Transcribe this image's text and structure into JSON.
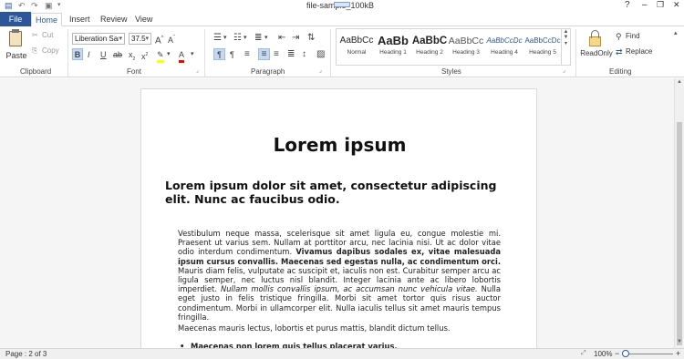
{
  "window": {
    "title": "file-sample_100kB"
  },
  "tabs": [
    {
      "label": "File"
    },
    {
      "label": "Home"
    },
    {
      "label": "Insert"
    },
    {
      "label": "Review"
    },
    {
      "label": "View"
    }
  ],
  "win_controls": {
    "help": "?",
    "minimize": "–",
    "restore": "❐",
    "close": "✕"
  },
  "ribbon": {
    "clipboard": {
      "label": "Clipboard",
      "paste": "Paste",
      "cut": "Cut",
      "copy": "Copy"
    },
    "font": {
      "label": "Font",
      "family": "Liberation Sans",
      "size": "37.5"
    },
    "paragraph": {
      "label": "Paragraph"
    },
    "styles": {
      "label": "Styles",
      "items": [
        {
          "sample": "AaBbCc",
          "name": "Normal"
        },
        {
          "sample": "AaBb",
          "name": "Heading 1"
        },
        {
          "sample": "AaBbC",
          "name": "Heading 2"
        },
        {
          "sample": "AaBbCc",
          "name": "Heading 3"
        },
        {
          "sample": "AaBbCcDc",
          "name": "Heading 4"
        },
        {
          "sample": "AaBbCcDc",
          "name": "Heading 5"
        }
      ]
    },
    "editing": {
      "label": "Editing",
      "readonly": "ReadOnly",
      "find": "Find",
      "replace": "Replace"
    }
  },
  "document": {
    "title": "Lorem ipsum",
    "subtitle": "Lorem ipsum dolor sit amet, consectetur adipiscing elit. Nunc ac faucibus odio.",
    "paragraph1": "Vestibulum neque massa, scelerisque sit amet ligula eu, congue molestie mi. Praesent ut varius sem. Nullam at porttitor arcu, nec lacinia nisi. Ut ac dolor vitae odio interdum condimentum.",
    "paragraph1_bold": "Vivamus dapibus sodales ex, vitae malesuada ipsum cursus convallis. Maecenas sed egestas nulla, ac condimentum orci.",
    "paragraph1_rest": "Mauris diam felis, vulputate ac suscipit et, iaculis non est. Curabitur semper arcu ac ligula semper, nec luctus nisl blandit. Integer lacinia ante ac libero lobortis imperdiet.",
    "paragraph1_italic": "Nullam mollis convallis ipsum, ac accumsan nunc vehicula vitae.",
    "paragraph1_end": "Nulla eget justo in felis tristique fringilla. Morbi sit amet tortor quis risus auctor condimentum. Morbi in ullamcorper elit. Nulla iaculis tellus sit amet mauris tempus fringilla.",
    "paragraph2": "Maecenas mauris lectus, lobortis et purus mattis, blandit dictum tellus.",
    "bullet1": "Maecenas non lorem quis tellus placerat varius."
  },
  "status": {
    "page": "Page : 2 of 3",
    "zoom": "100%",
    "zoom_minus": "−",
    "zoom_plus": "+"
  },
  "colors": {
    "accent": "#2b579a",
    "highlight": "#ffff00",
    "font_color": "#ff0000"
  }
}
